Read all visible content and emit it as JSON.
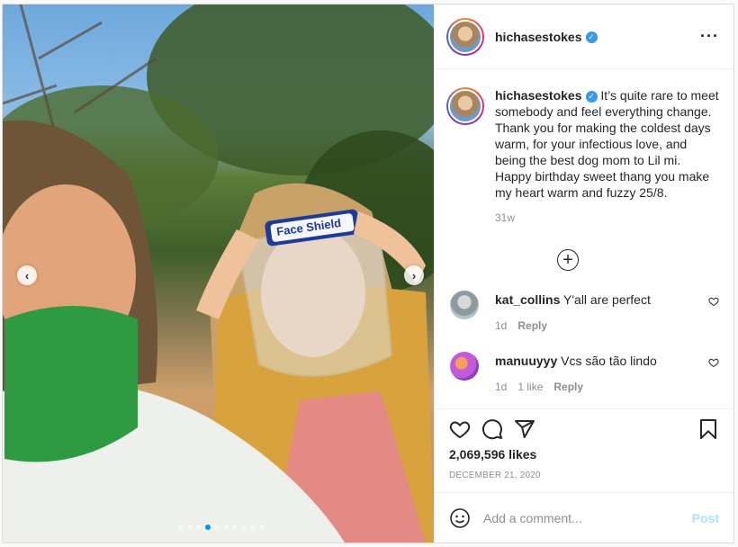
{
  "post": {
    "username": "hichasestokes",
    "verified": true,
    "caption": "It’s quite rare to meet somebody and feel everything change. Thank you for making the coldest days warm, for your infectious love, and being the best dog mom to Lil mi. Happy birthday sweet thang you make my heart warm and fuzzy 25/8.",
    "caption_time": "31w",
    "likes": "2,069,596 likes",
    "date": "DECEMBER 21, 2020",
    "more_icon": "more-options-icon",
    "photo_text": "Face Shield",
    "carousel": {
      "total": 10,
      "active": 3
    }
  },
  "comments": [
    {
      "username": "kat_collins",
      "text": "Y'all are perfect",
      "time": "1d",
      "likes": "",
      "reply": "Reply"
    },
    {
      "username": "manuuyyy",
      "text": "Vcs são tão lindo",
      "time": "1d",
      "likes": "1 like",
      "reply": "Reply"
    }
  ],
  "add_comment": {
    "placeholder": "Add a comment...",
    "post_label": "Post"
  },
  "colors": {
    "accent": "#0095f6",
    "verified": "#3897f0",
    "post_disabled": "#b2dffc"
  }
}
